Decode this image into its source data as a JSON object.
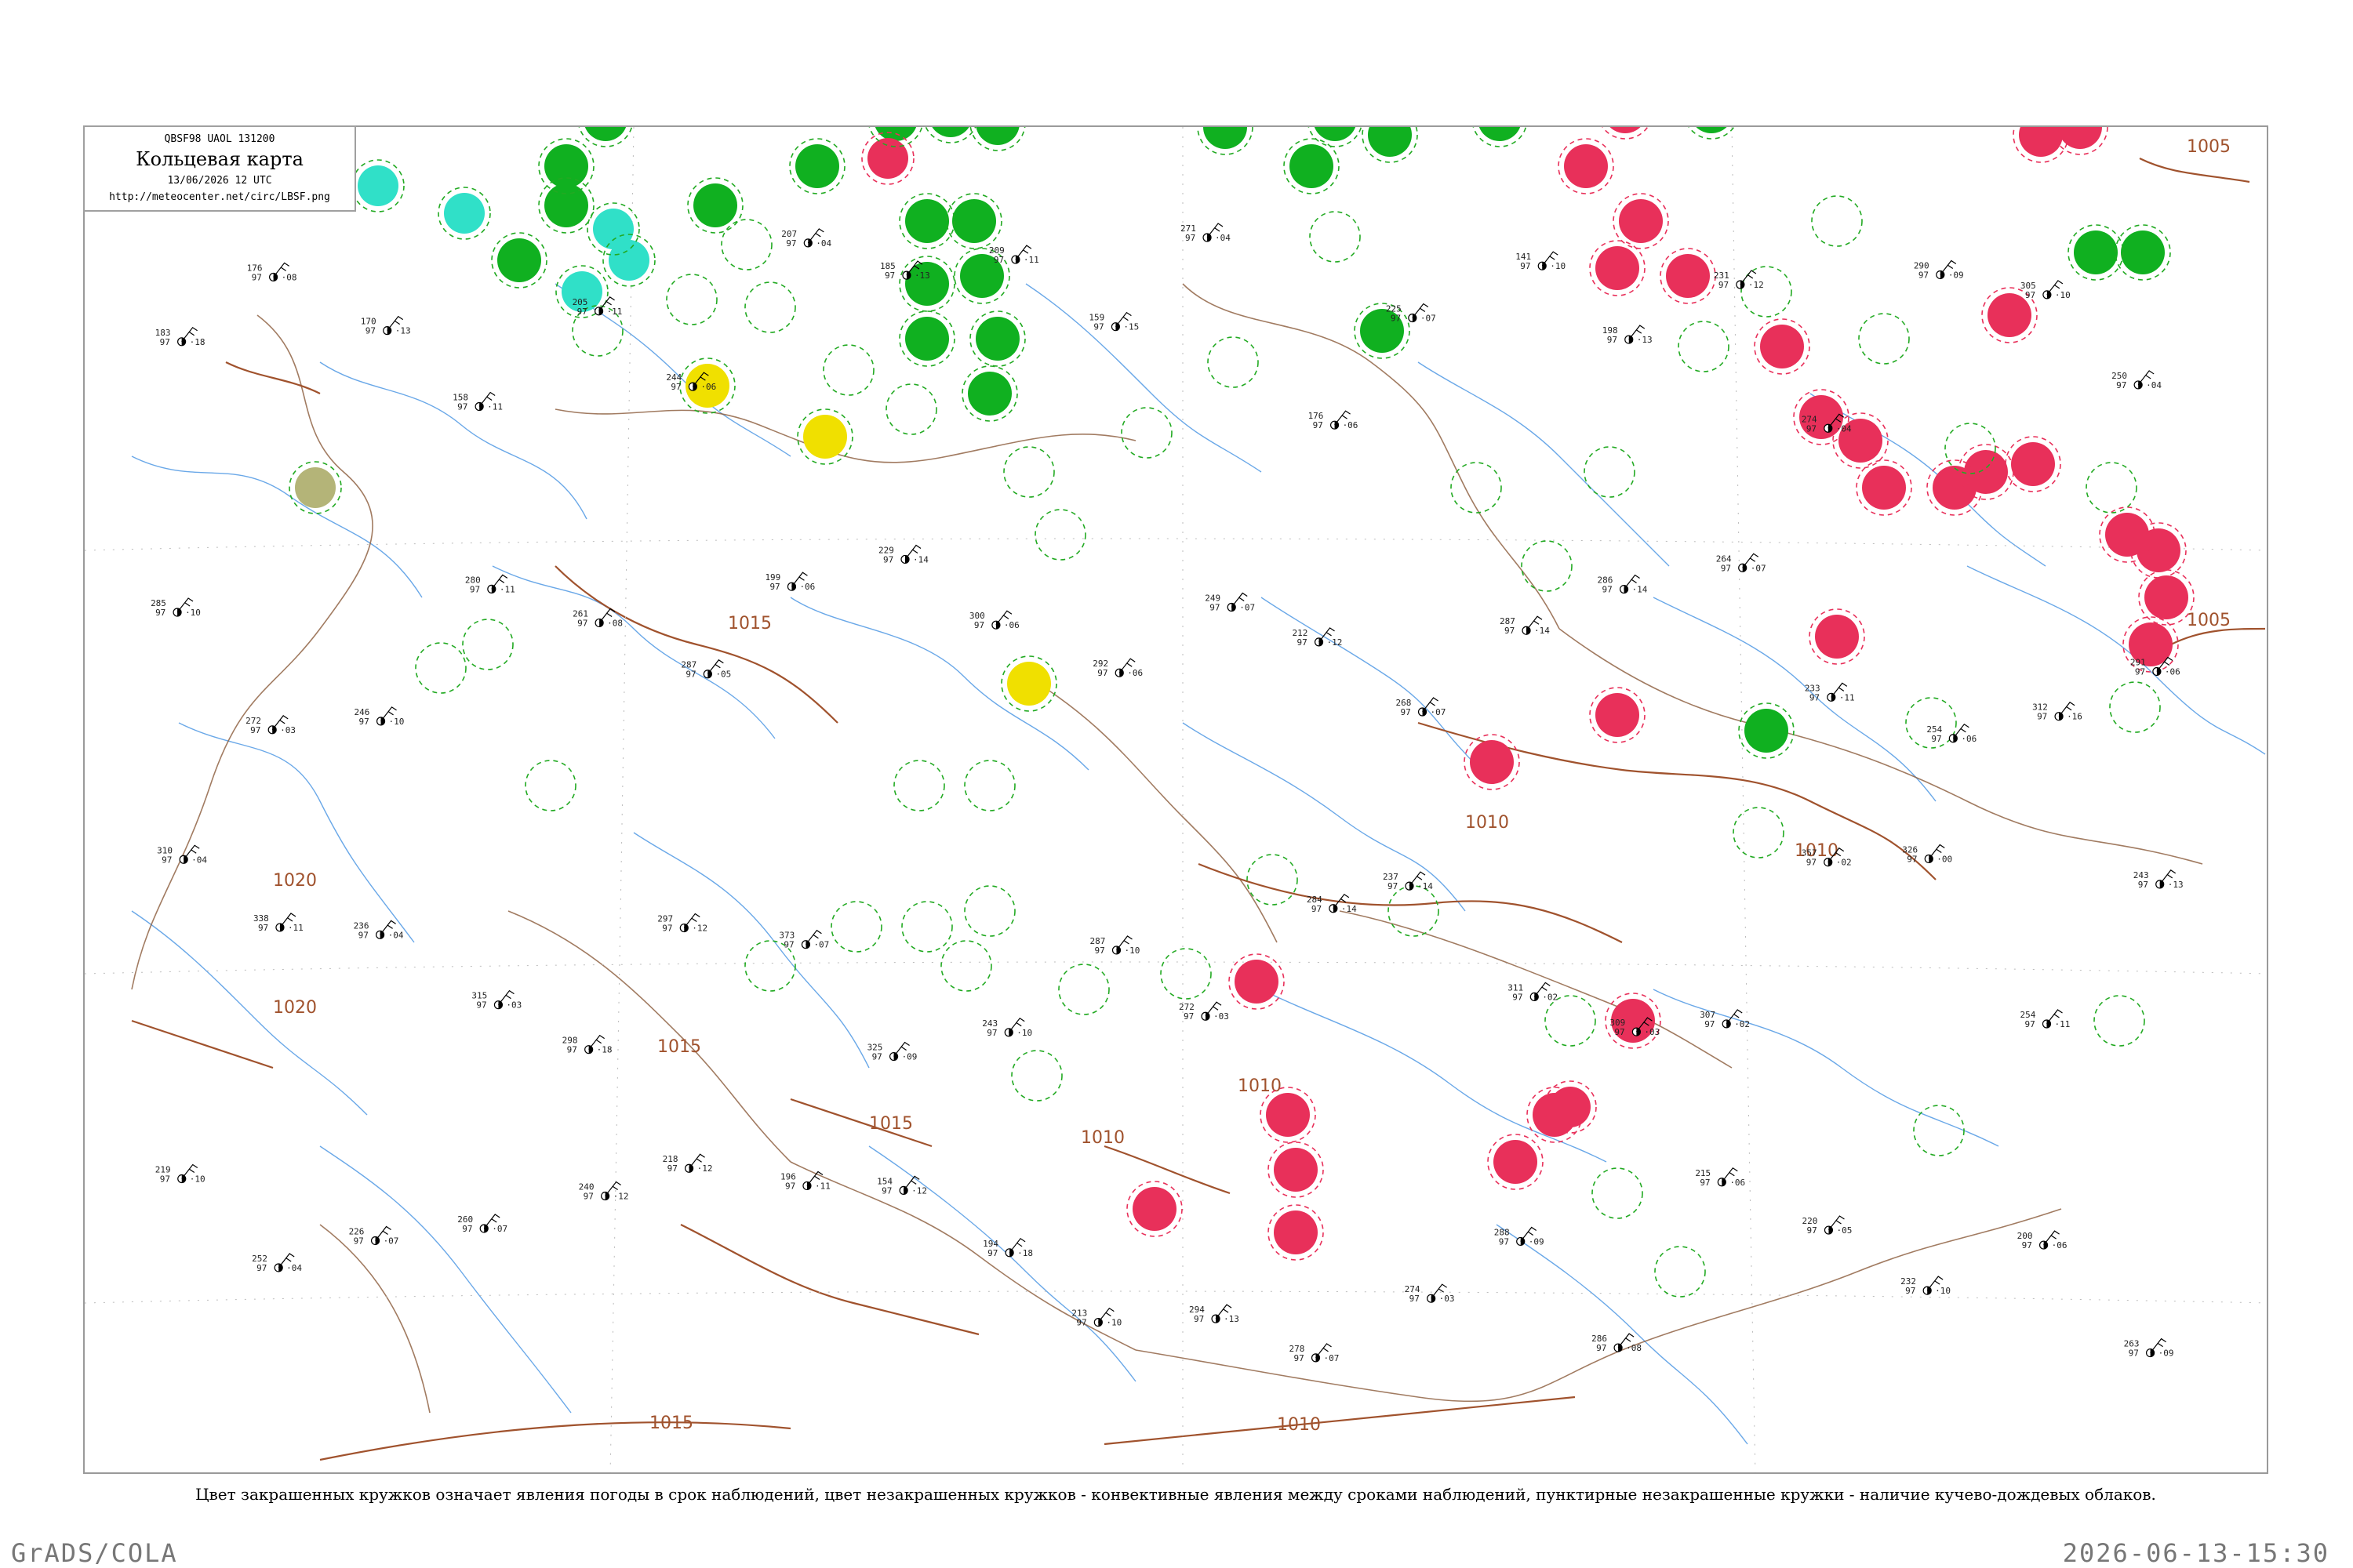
{
  "header": {
    "code_line": "QBSF98  UAOL  131200",
    "title": "Кольцевая карта",
    "date_line": "13/06/2026 12 UTC",
    "url": "http://meteocenter.net/circ/LBSF.png"
  },
  "caption": "Цвет закрашенных кружков означает явления погоды в срок наблюдений, цвет незакрашенных кружков - конвективные явления между сроками наблюдений, пунктирные незакрашенные кружки - наличие кучево-дождевых облаков.",
  "footer": {
    "left": "GrADS/COLA",
    "right": "2026-06-13-15:30"
  },
  "colors": {
    "thunder_red": "#e8305a",
    "rain_green": "#10b020",
    "shower_cyan": "#30e0c8",
    "fog_yellow": "#f0e000",
    "haze_olive": "#b4b478",
    "isobar": "#a0522d",
    "rivers": "#6aa8e8",
    "cb_dashed": "#22aa22"
  },
  "isobars": [
    {
      "label": "1005"
    },
    {
      "label": "1005"
    },
    {
      "label": "1010"
    },
    {
      "label": "1010"
    },
    {
      "label": "1010"
    },
    {
      "label": "1010"
    },
    {
      "label": "1015"
    },
    {
      "label": "1015"
    },
    {
      "label": "1015"
    },
    {
      "label": "1015"
    },
    {
      "label": "1020"
    },
    {
      "label": "1020"
    },
    {
      "label": "1010"
    }
  ],
  "stations": [
    {
      "t": "183",
      "p": "97",
      "d": "·18"
    },
    {
      "t": "176",
      "p": "97",
      "d": "·08"
    },
    {
      "t": "170",
      "p": "97",
      "d": "·13"
    },
    {
      "t": "158",
      "p": "97",
      "d": "·11"
    },
    {
      "t": "205",
      "p": "97",
      "d": "·11"
    },
    {
      "t": "244",
      "p": "97",
      "d": "·06"
    },
    {
      "t": "207",
      "p": "97",
      "d": "·04"
    },
    {
      "t": "185",
      "p": "97",
      "d": "·13"
    },
    {
      "t": "209",
      "p": "97",
      "d": "·11"
    },
    {
      "t": "159",
      "p": "97",
      "d": "·15"
    },
    {
      "t": "271",
      "p": "97",
      "d": "·04"
    },
    {
      "t": "176",
      "p": "97",
      "d": "·06"
    },
    {
      "t": "225",
      "p": "97",
      "d": "·07"
    },
    {
      "t": "141",
      "p": "97",
      "d": "·10"
    },
    {
      "t": "198",
      "p": "97",
      "d": "·13"
    },
    {
      "t": "231",
      "p": "97",
      "d": "·12"
    },
    {
      "t": "274",
      "p": "97",
      "d": "·04"
    },
    {
      "t": "290",
      "p": "97",
      "d": "·09"
    },
    {
      "t": "305",
      "p": "97",
      "d": "·10"
    },
    {
      "t": "250",
      "p": "97",
      "d": "·04"
    },
    {
      "t": "285",
      "p": "97",
      "d": "·10"
    },
    {
      "t": "272",
      "p": "97",
      "d": "·03"
    },
    {
      "t": "246",
      "p": "97",
      "d": "·10"
    },
    {
      "t": "280",
      "p": "97",
      "d": "·11"
    },
    {
      "t": "261",
      "p": "97",
      "d": "·08"
    },
    {
      "t": "287",
      "p": "97",
      "d": "·05"
    },
    {
      "t": "199",
      "p": "97",
      "d": "·06"
    },
    {
      "t": "229",
      "p": "97",
      "d": "·14"
    },
    {
      "t": "300",
      "p": "97",
      "d": "·06"
    },
    {
      "t": "292",
      "p": "97",
      "d": "·06"
    },
    {
      "t": "249",
      "p": "97",
      "d": "·07"
    },
    {
      "t": "212",
      "p": "97",
      "d": "·12"
    },
    {
      "t": "268",
      "p": "97",
      "d": "·07"
    },
    {
      "t": "287",
      "p": "97",
      "d": "·14"
    },
    {
      "t": "286",
      "p": "97",
      "d": "·14"
    },
    {
      "t": "264",
      "p": "97",
      "d": "·07"
    },
    {
      "t": "233",
      "p": "97",
      "d": "·11"
    },
    {
      "t": "254",
      "p": "97",
      "d": "·06"
    },
    {
      "t": "312",
      "p": "97",
      "d": "·16"
    },
    {
      "t": "291",
      "p": "97",
      "d": "·06"
    },
    {
      "t": "310",
      "p": "97",
      "d": "·04"
    },
    {
      "t": "338",
      "p": "97",
      "d": "·11"
    },
    {
      "t": "236",
      "p": "97",
      "d": "·04"
    },
    {
      "t": "315",
      "p": "97",
      "d": "·03"
    },
    {
      "t": "298",
      "p": "97",
      "d": "·18"
    },
    {
      "t": "297",
      "p": "97",
      "d": "·12"
    },
    {
      "t": "373",
      "p": "97",
      "d": "·07"
    },
    {
      "t": "325",
      "p": "97",
      "d": "·09"
    },
    {
      "t": "243",
      "p": "97",
      "d": "·10"
    },
    {
      "t": "287",
      "p": "97",
      "d": "·10"
    },
    {
      "t": "272",
      "p": "97",
      "d": "·03"
    },
    {
      "t": "284",
      "p": "97",
      "d": "·14"
    },
    {
      "t": "237",
      "p": "97",
      "d": "·14"
    },
    {
      "t": "311",
      "p": "97",
      "d": "·02"
    },
    {
      "t": "309",
      "p": "97",
      "d": "·03"
    },
    {
      "t": "307",
      "p": "97",
      "d": "·02"
    },
    {
      "t": "357",
      "p": "97",
      "d": "·02"
    },
    {
      "t": "326",
      "p": "97",
      "d": "·00"
    },
    {
      "t": "254",
      "p": "97",
      "d": "·11"
    },
    {
      "t": "243",
      "p": "97",
      "d": "·13"
    },
    {
      "t": "219",
      "p": "97",
      "d": "·10"
    },
    {
      "t": "252",
      "p": "97",
      "d": "·04"
    },
    {
      "t": "226",
      "p": "97",
      "d": "·07"
    },
    {
      "t": "260",
      "p": "97",
      "d": "·07"
    },
    {
      "t": "240",
      "p": "97",
      "d": "·12"
    },
    {
      "t": "218",
      "p": "97",
      "d": "·12"
    },
    {
      "t": "196",
      "p": "97",
      "d": "·11"
    },
    {
      "t": "154",
      "p": "97",
      "d": "·12"
    },
    {
      "t": "194",
      "p": "97",
      "d": "·18"
    },
    {
      "t": "213",
      "p": "97",
      "d": "·10"
    },
    {
      "t": "294",
      "p": "97",
      "d": "·13"
    },
    {
      "t": "278",
      "p": "97",
      "d": "·07"
    },
    {
      "t": "274",
      "p": "97",
      "d": "·03"
    },
    {
      "t": "288",
      "p": "97",
      "d": "·09"
    },
    {
      "t": "286",
      "p": "97",
      "d": "·08"
    },
    {
      "t": "215",
      "p": "97",
      "d": "·06"
    },
    {
      "t": "220",
      "p": "97",
      "d": "·05"
    },
    {
      "t": "232",
      "p": "97",
      "d": "·10"
    },
    {
      "t": "200",
      "p": "97",
      "d": "·06"
    },
    {
      "t": "263",
      "p": "97",
      "d": "·09"
    }
  ]
}
